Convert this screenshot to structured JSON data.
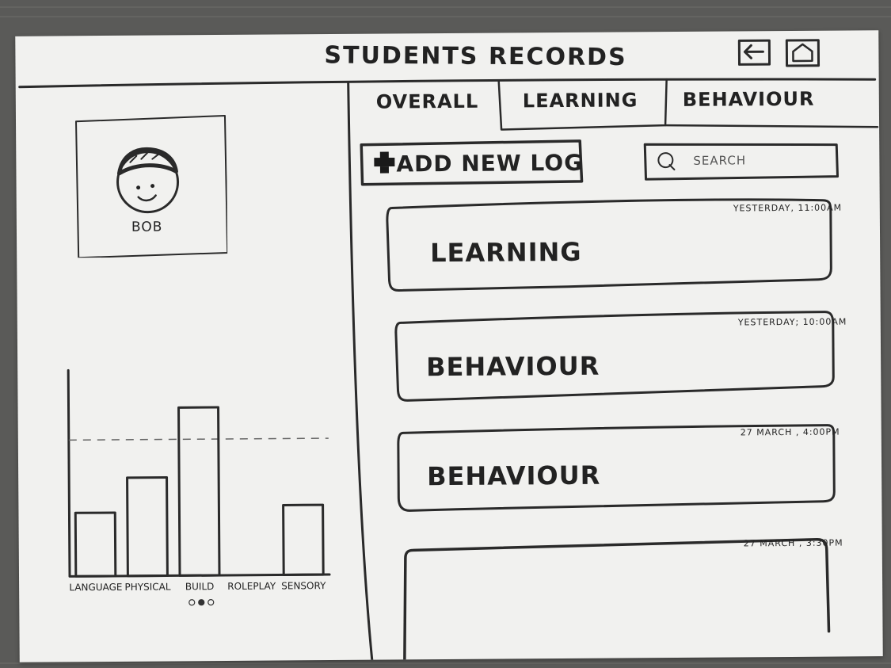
{
  "header": {
    "title": "STUDENTS RECORDS",
    "back_icon": "back-arrow-icon",
    "home_icon": "home-icon"
  },
  "tabs": [
    {
      "label": "OVERALL",
      "selected": true
    },
    {
      "label": "LEARNING",
      "selected": false
    },
    {
      "label": "BEHAVIOUR",
      "selected": false
    }
  ],
  "student": {
    "name": "BOB",
    "avatar_icon": "smiling-face-avatar-icon"
  },
  "actions": {
    "add_log_label": "ADD NEW LOG",
    "add_icon": "plus-icon",
    "search_placeholder": "SEARCH",
    "search_icon": "search-icon"
  },
  "logs": [
    {
      "title": "LEARNING",
      "time": "YESTERDAY, 11:00AM"
    },
    {
      "title": "BEHAVIOUR",
      "time": "YESTERDAY; 10:00AM"
    },
    {
      "title": "BEHAVIOUR",
      "time": "27 MARCH , 4:00PM"
    },
    {
      "title": "",
      "time": "27 MARCH , 3:30PM"
    }
  ],
  "pagination": {
    "pages": 3,
    "current": 2
  },
  "chart_data": {
    "type": "bar",
    "categories": [
      "LANGUAGE",
      "PHYSICAL",
      "BUILD",
      "ROLEPLAY",
      "SENSORY"
    ],
    "values": [
      2.0,
      3.1,
      5.3,
      0,
      2.2
    ],
    "reference_line": 4.3,
    "reference_line_style": "dashed",
    "ylim": [
      0,
      6.5
    ],
    "title": "",
    "xlabel": "",
    "ylabel": ""
  }
}
